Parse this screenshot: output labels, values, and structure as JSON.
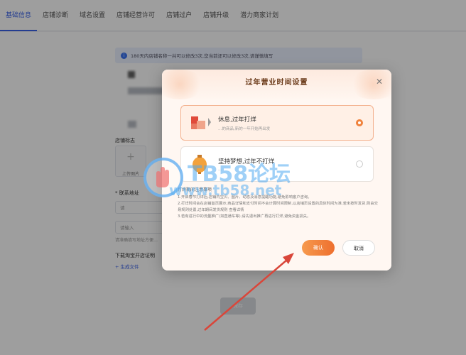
{
  "tabs": [
    {
      "label": "基础信息",
      "active": true
    },
    {
      "label": "店铺诊断"
    },
    {
      "label": "域名设置"
    },
    {
      "label": "店铺经营许可"
    },
    {
      "label": "店铺过户"
    },
    {
      "label": "店铺升级"
    },
    {
      "label": "潜力商家计划"
    }
  ],
  "page": {
    "notice": "180天内店铺名称一共可以修改3次,您当前还可以修改3次,请谨慎填写",
    "logo_label": "店铺标志",
    "upload_label": "上传图片",
    "contact_label": "* 联系地址",
    "contact_select": "请",
    "address_placeholder": "请输入",
    "address_hint": "请准确填写地址方便…",
    "license_label": "下载淘宝开店证明",
    "generate_link": "+ 生成文件",
    "save_label": "保存"
  },
  "modal": {
    "title": "过年营业时间设置",
    "close_icon": "close-icon",
    "options": [
      {
        "title": "休息,过年打烊",
        "desc": "…的商品,新的一年开始再出发",
        "checked": true
      },
      {
        "title": "坚持梦想,过年不打烊",
        "desc": "…",
        "checked": false
      }
    ],
    "tips_title": "打烊期间注意事项",
    "tips": [
      "1.开启春节打烊后,店铺内宝贝、图片、动态及消息提醒功能,避免影响客户咨询。",
      "2.打烊时间会在店铺首页展示,商品详情和支付时间不会计算时间限制,以店铺页设置的具体时间为准,若未按时发货,则由交易规则处置,过年期间发货规则 查看详情",
      "3.若有进行中的流量推广(如直通车等),请先退出推广再进行打烊,避免资金损失。"
    ],
    "confirm_label": "确认",
    "cancel_label": "取消"
  },
  "watermark": {
    "brand": "TB58论坛",
    "url": "www.tb58.net"
  },
  "colors": {
    "accent": "#3b63e8",
    "confirm": "#ee6f2e",
    "selected_border": "#f3b08d"
  }
}
